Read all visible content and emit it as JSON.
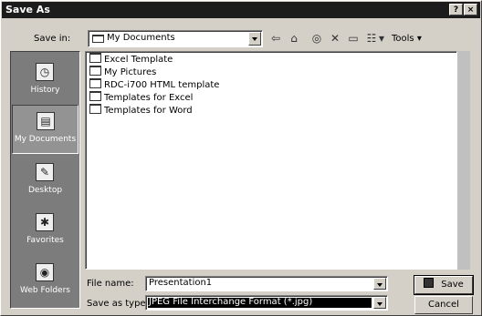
{
  "window": {
    "title": "Save As",
    "help_label": "?",
    "close_label": "×"
  },
  "toolbar": {
    "save_in_label": "Save in:",
    "save_in_value": "My Documents",
    "tools_label": "Tools",
    "icons": [
      "back-icon",
      "up-folder-icon",
      "search-web-icon",
      "delete-icon",
      "new-folder-icon",
      "views-icon"
    ]
  },
  "places": [
    {
      "label": "History",
      "icon": "history-icon"
    },
    {
      "label": "My Documents",
      "icon": "my-documents-icon"
    },
    {
      "label": "Desktop",
      "icon": "desktop-icon"
    },
    {
      "label": "Favorites",
      "icon": "favorites-icon"
    },
    {
      "label": "Web Folders",
      "icon": "web-folders-icon"
    }
  ],
  "files": [
    "Excel Template",
    "My Pictures",
    "RDC-i700 HTML template",
    "Templates for Excel",
    "Templates for Word"
  ],
  "file_name": {
    "label": "File name:",
    "value": "Presentation1"
  },
  "save_as_type": {
    "label": "Save as type:",
    "value": "JPEG File Interchange Format (*.jpg)"
  },
  "buttons": {
    "save": "Save",
    "cancel": "Cancel"
  }
}
